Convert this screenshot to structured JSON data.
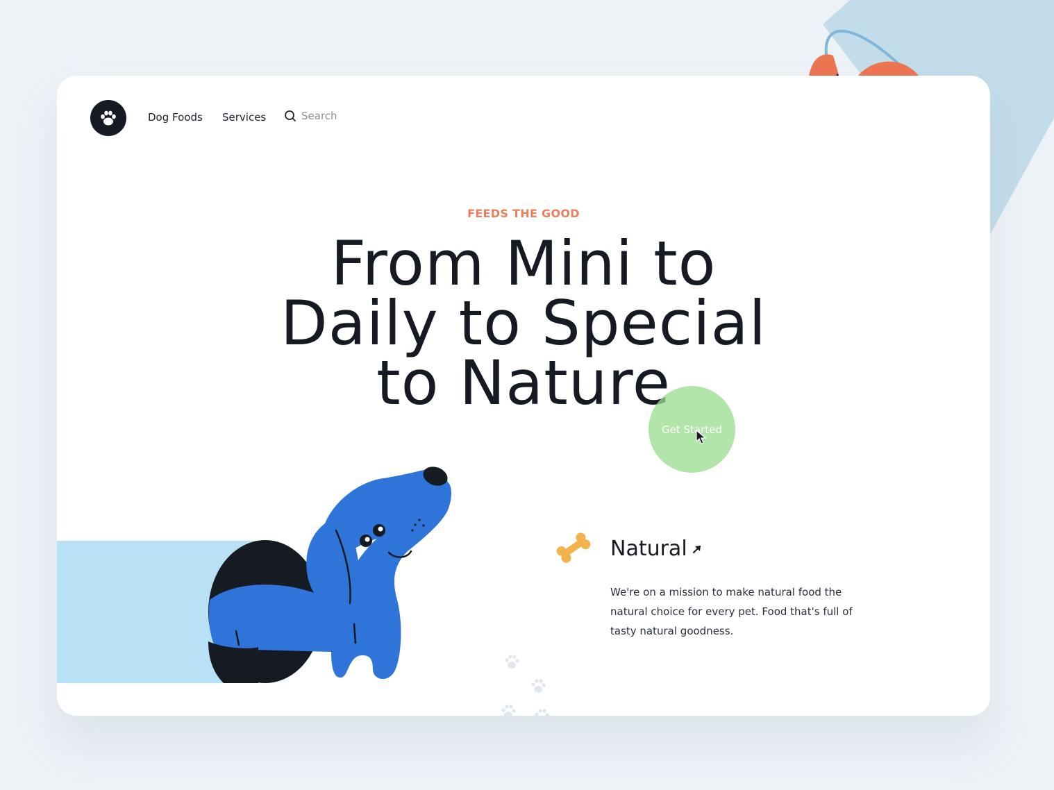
{
  "nav": {
    "logo_icon": "paw-icon",
    "links": [
      "Dog Foods",
      "Services"
    ],
    "search_placeholder": "Search"
  },
  "hero": {
    "eyebrow": "FEEDS THE GOOD",
    "headline_lines": [
      "From Mini to",
      "Daily to Special",
      "to Nature"
    ],
    "cta_label": "Get Started"
  },
  "feature": {
    "icon": "bone-icon",
    "title": "Natural",
    "title_icon": "arrow-up-right-icon",
    "description": "We're on a mission to make natural food the natural choice for every pet. Food that's full of tasty natural goodness."
  },
  "colors": {
    "page_bg": "#edf2f7",
    "card_bg": "#ffffff",
    "dark": "#161a22",
    "accent_orange": "#e8805c",
    "cta_green": "#b1e5a6",
    "dog_blue": "#2f74d8",
    "light_blue": "#b8e1f5",
    "bone_yellow": "#f3b24e",
    "cone_blue": "#c3dcea"
  }
}
